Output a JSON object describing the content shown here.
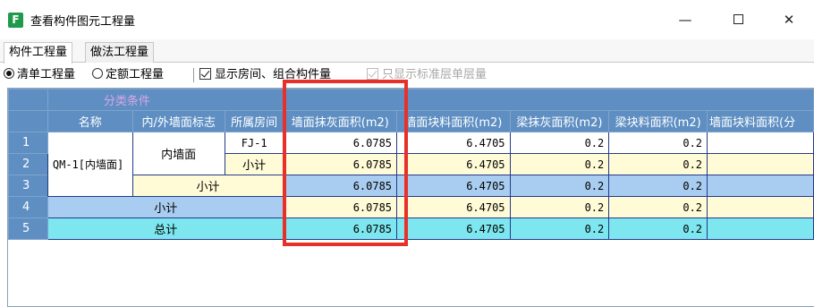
{
  "window": {
    "icon_letter": "F",
    "title": "查看构件图元工程量",
    "min_glyph": "—",
    "close_glyph": "✕"
  },
  "tabs": [
    "构件工程量",
    "做法工程量"
  ],
  "options": {
    "radio_list": "清单工程量",
    "radio_quota": "定额工程量",
    "check_rooms": "显示房间、组合构件量",
    "check_standard": "只显示标准层单层量"
  },
  "table": {
    "group_header": "分类条件",
    "columns": [
      "名称",
      "内/外墙面标志",
      "所属房间",
      "墙面抹灰面积(m2)",
      "墙面块料面积(m2)",
      "梁抹灰面积(m2)",
      "梁块料面积(m2)",
      "墙面块料面积(分"
    ],
    "row_numbers": [
      "1",
      "2",
      "3",
      "4",
      "5"
    ],
    "name_value": "QM-1[内墙面]",
    "flag_value": "内墙面",
    "room_value": "FJ-1",
    "subtotal": "小计",
    "total": "总计",
    "rows": [
      [
        "6.0785",
        "6.4705",
        "0.2",
        "0.2",
        ""
      ],
      [
        "6.0785",
        "6.4705",
        "0.2",
        "0.2",
        ""
      ],
      [
        "6.0785",
        "6.4705",
        "0.2",
        "0.2",
        ""
      ],
      [
        "6.0785",
        "6.4705",
        "0.2",
        "0.2",
        ""
      ],
      [
        "6.0785",
        "6.4705",
        "0.2",
        "0.2",
        ""
      ]
    ]
  },
  "colors": {
    "header_blue": "#5f8fc2",
    "subtotal_blue": "#a9cdf0",
    "total_cyan": "#7de6ee",
    "cream": "#fffbd7",
    "highlight_red": "#e8302a"
  }
}
